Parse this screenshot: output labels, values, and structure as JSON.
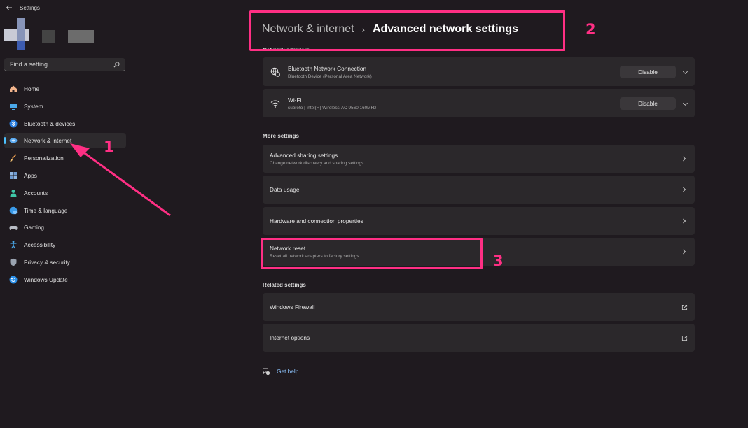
{
  "app": {
    "title": "Settings"
  },
  "search": {
    "placeholder": "Find a setting"
  },
  "nav": {
    "items": [
      {
        "label": "Home",
        "icon": "home-icon"
      },
      {
        "label": "System",
        "icon": "system-icon"
      },
      {
        "label": "Bluetooth & devices",
        "icon": "bluetooth-icon"
      },
      {
        "label": "Network & internet",
        "icon": "network-icon",
        "active": true
      },
      {
        "label": "Personalization",
        "icon": "brush-icon"
      },
      {
        "label": "Apps",
        "icon": "apps-icon"
      },
      {
        "label": "Accounts",
        "icon": "account-icon"
      },
      {
        "label": "Time & language",
        "icon": "globe-icon"
      },
      {
        "label": "Gaming",
        "icon": "gamepad-icon"
      },
      {
        "label": "Accessibility",
        "icon": "accessibility-icon"
      },
      {
        "label": "Privacy & security",
        "icon": "shield-icon"
      },
      {
        "label": "Windows Update",
        "icon": "update-icon"
      }
    ]
  },
  "breadcrumb": {
    "parent": "Network & internet",
    "separator": "›",
    "current": "Advanced network settings"
  },
  "sections": {
    "adapters_title": "Network adapters",
    "more_title": "More settings",
    "related_title": "Related settings"
  },
  "adapters": [
    {
      "name": "Bluetooth Network Connection",
      "detail": "Bluetooth Device (Personal Area Network)",
      "action": "Disable",
      "icon": "bluetooth-network-icon"
    },
    {
      "name": "Wi-Fi",
      "detail": "subreto | Intel(R) Wireless-AC 9560 160MHz",
      "action": "Disable",
      "icon": "wifi-icon"
    }
  ],
  "more_settings": [
    {
      "title": "Advanced sharing settings",
      "subtitle": "Change network discovery and sharing settings"
    },
    {
      "title": "Data usage",
      "subtitle": ""
    },
    {
      "title": "Hardware and connection properties",
      "subtitle": ""
    },
    {
      "title": "Network reset",
      "subtitle": "Reset all network adapters to factory settings"
    }
  ],
  "related_settings": [
    {
      "title": "Windows Firewall"
    },
    {
      "title": "Internet options"
    }
  ],
  "help": {
    "label": "Get help"
  },
  "annotations": {
    "one": "1",
    "two": "2",
    "three": "3"
  },
  "colors": {
    "background": "#1f1a1f",
    "card": "#2b282b",
    "accent": "#4cc2ff",
    "annotation": "#ff2f84",
    "link": "#8ec5ff"
  }
}
